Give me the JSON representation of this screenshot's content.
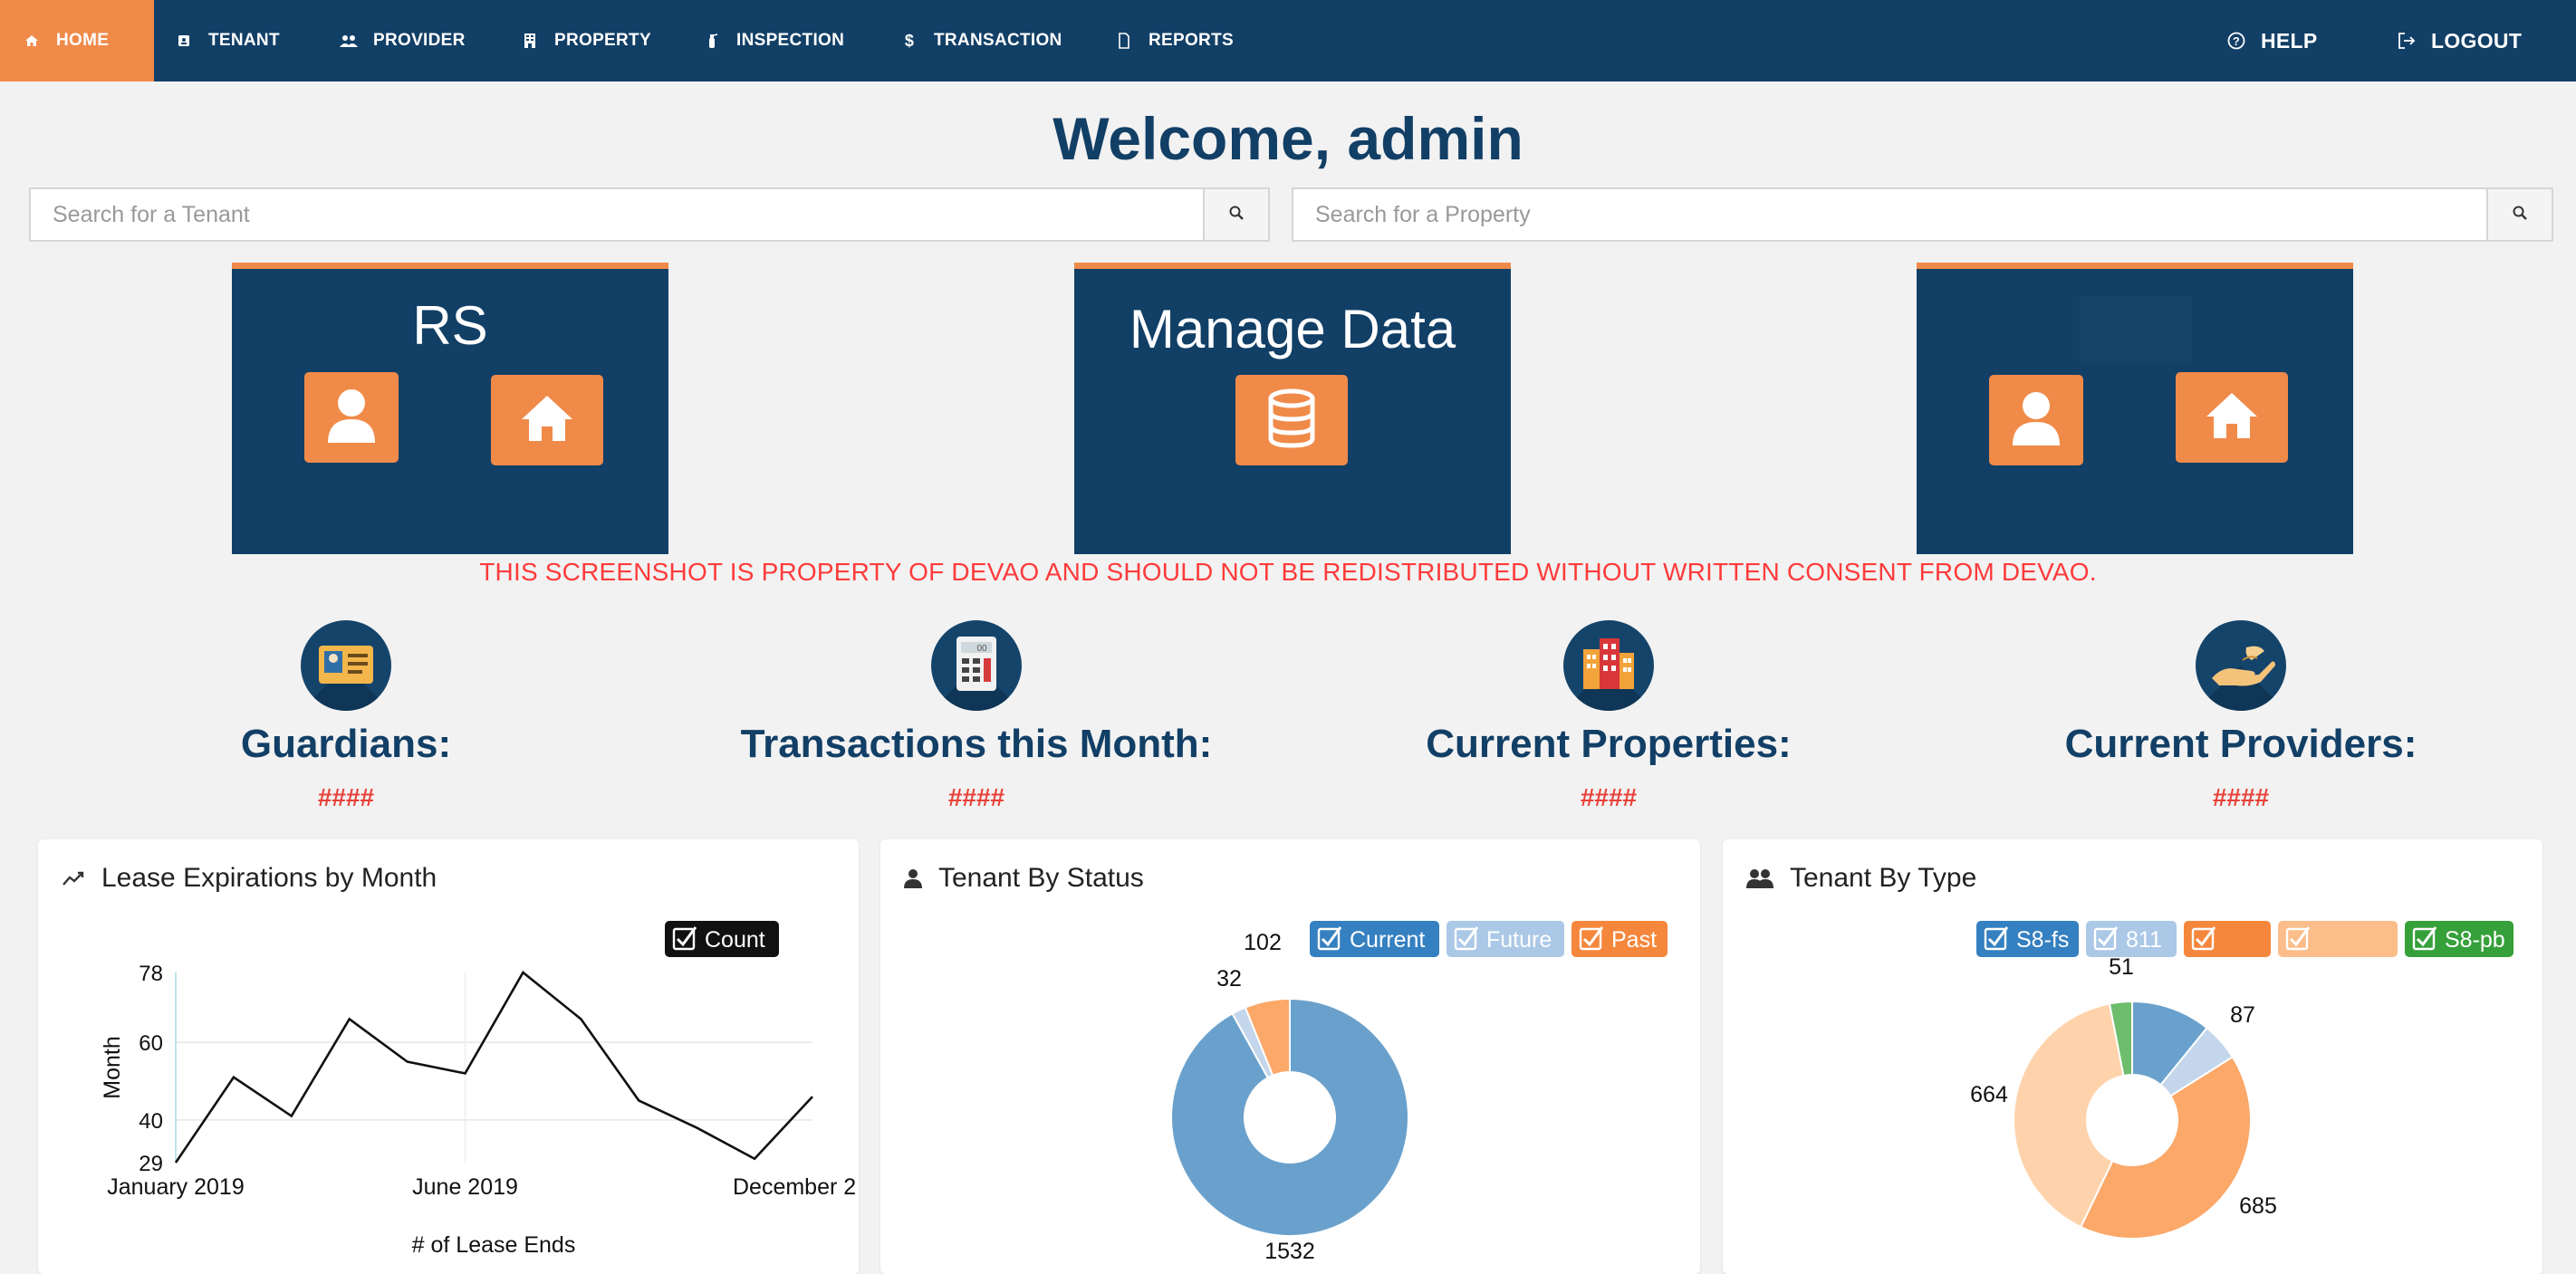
{
  "nav": {
    "items": [
      {
        "label": "HOME",
        "icon": "home-icon",
        "active": true
      },
      {
        "label": "TENANT",
        "icon": "id-card-icon"
      },
      {
        "label": "PROVIDER",
        "icon": "users-icon"
      },
      {
        "label": "PROPERTY",
        "icon": "building-icon"
      },
      {
        "label": "INSPECTION",
        "icon": "fire-extinguisher-icon"
      },
      {
        "label": "TRANSACTION",
        "icon": "dollar-icon"
      },
      {
        "label": "REPORTS",
        "icon": "file-icon"
      }
    ],
    "help": "HELP",
    "logout": "LOGOUT"
  },
  "welcome": "Welcome, admin",
  "search": {
    "tenant_placeholder": "Search for a Tenant",
    "property_placeholder": "Search for a Property"
  },
  "tiles": [
    {
      "title": "RS",
      "buttons": [
        "user-icon",
        "home-icon"
      ]
    },
    {
      "title": "Manage Data",
      "buttons": [
        "database-icon"
      ]
    },
    {
      "title": "",
      "buttons": [
        "user-icon",
        "home-icon"
      ]
    }
  ],
  "watermark": "THIS SCREENSHOT IS PROPERTY OF DEVAO AND SHOULD NOT BE REDISTRIBUTED WITHOUT WRITTEN CONSENT FROM DEVAO.",
  "stats": [
    {
      "label": "Guardians:",
      "value": "####",
      "icon": "id-card-icon"
    },
    {
      "label": "Transactions this Month:",
      "value": "####",
      "icon": "calculator-icon"
    },
    {
      "label": "Current Properties:",
      "value": "####",
      "icon": "buildings-icon"
    },
    {
      "label": "Current Providers:",
      "value": "####",
      "icon": "hand-icon"
    }
  ],
  "panels": {
    "lease": {
      "title": "Lease Expirations by Month",
      "icon": "line-chart-icon"
    },
    "status": {
      "title": "Tenant By Status",
      "icon": "user-icon"
    },
    "type": {
      "title": "Tenant By Type",
      "icon": "users-icon"
    }
  },
  "colors": {
    "navy": "#123f66",
    "orange": "#f08a49",
    "alert_red": "#e8423a"
  },
  "chart_data": [
    {
      "type": "line",
      "title": "Lease Expirations by Month",
      "xlabel": "# of Lease Ends",
      "ylabel": "Month",
      "x_tick_labels": [
        "January 2019",
        "June 2019",
        "December 2"
      ],
      "y_tick_labels": [
        "29",
        "40",
        "60",
        "78"
      ],
      "ylim": [
        29,
        78
      ],
      "legend": [
        {
          "label": "Count",
          "color": "#111111",
          "checked": true
        }
      ],
      "series": [
        {
          "name": "Count",
          "values": [
            29,
            51,
            41,
            66,
            55,
            52,
            78,
            66,
            45,
            38,
            30,
            46
          ]
        }
      ],
      "grid": true
    },
    {
      "type": "pie",
      "title": "Tenant By Status",
      "donut": true,
      "slices": [
        {
          "name": "Current",
          "value": 1532,
          "color": "#6aa1cc"
        },
        {
          "name": "Future",
          "value": 32,
          "color": "#c3d6ec"
        },
        {
          "name": "Past",
          "value": 102,
          "color": "#fba869"
        }
      ],
      "legend": [
        {
          "label": "Current",
          "color": "#3580c0"
        },
        {
          "label": "Future",
          "color": "#abc8e6"
        },
        {
          "label": "Past",
          "color": "#f5873c"
        }
      ],
      "legend_placement": "top-right"
    },
    {
      "type": "pie",
      "title": "Tenant By Type",
      "donut": true,
      "slices": [
        {
          "name": "S8-fs",
          "value": 181,
          "color": "#6aa1cc"
        },
        {
          "name": "811",
          "value": 87,
          "color": "#c3d6ec"
        },
        {
          "name": "",
          "value": 685,
          "color": "#fba869"
        },
        {
          "name": "",
          "value": 664,
          "color": "#fed3ac"
        },
        {
          "name": "S8-pb",
          "value": 51,
          "color": "#6dbd6d"
        }
      ],
      "legend": [
        {
          "label": "S8-fs",
          "color": "#3580c0"
        },
        {
          "label": "811",
          "color": "#abc8e6"
        },
        {
          "label": "",
          "color": "#f5873c"
        },
        {
          "label": "",
          "color": "#fbbd8a"
        },
        {
          "label": "S8-pb",
          "color": "#36a03a"
        }
      ],
      "legend_placement": "top-right"
    }
  ]
}
